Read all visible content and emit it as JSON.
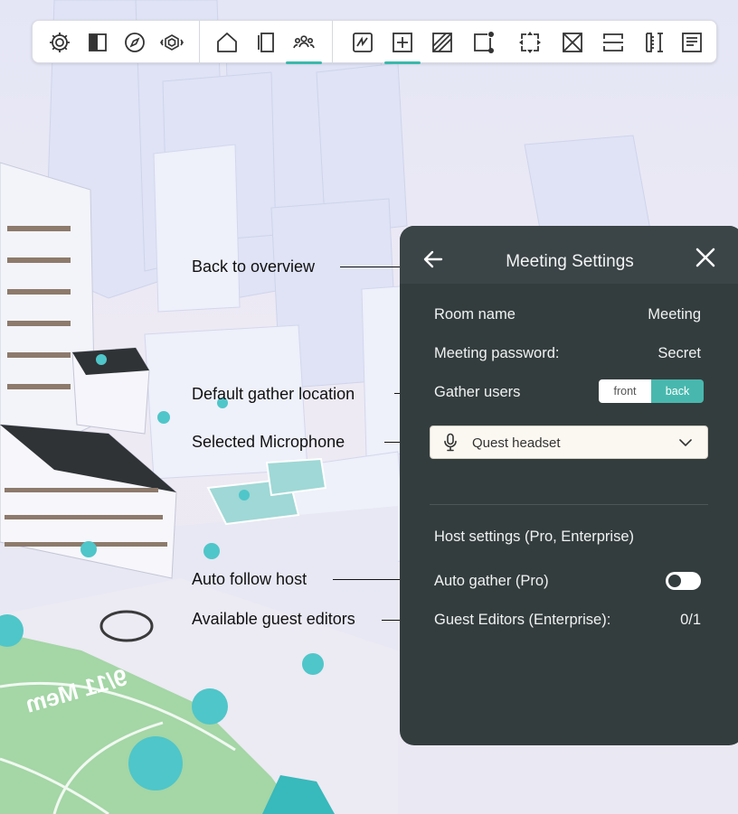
{
  "toolbar": {
    "accent": "#3bb8ac",
    "groups": [
      [
        "settings-gear-icon",
        "split-view-icon",
        "compass-icon",
        "view-cube-icon"
      ],
      [
        "home-icon",
        "panels-icon",
        "meeting-users-icon"
      ],
      [
        "sketch-icon",
        "add-plus-icon",
        "hatch-icon",
        "selection-points-icon",
        "resize-frame-icon",
        "remove-x-icon",
        "section-icon",
        "measure-icon",
        "notes-icon"
      ]
    ]
  },
  "annotations": {
    "back": "Back to overview",
    "gather": "Default gather location",
    "microphone": "Selected Microphone",
    "follow": "Auto follow host",
    "editors": "Available guest editors"
  },
  "panel": {
    "title": "Meeting Settings",
    "back_icon": "arrow-left-icon",
    "close_icon": "close-x-icon",
    "room_name_label": "Room name",
    "room_name_value": "Meeting",
    "password_label": "Meeting password:",
    "password_value": "Secret",
    "gather_label": "Gather users",
    "gather_options": {
      "front": "front",
      "back": "back"
    },
    "gather_selected": "back",
    "microphone": "Quest headset",
    "host_section": "Host settings (Pro, Enterprise)",
    "auto_gather_label": "Auto gather (Pro)",
    "auto_gather_on": false,
    "guest_editors_label": "Guest Editors (Enterprise):",
    "guest_editors_value": "0/1",
    "colors": {
      "panel": "#343d3e",
      "header": "#3b4446",
      "accent": "#48b8ae"
    }
  }
}
